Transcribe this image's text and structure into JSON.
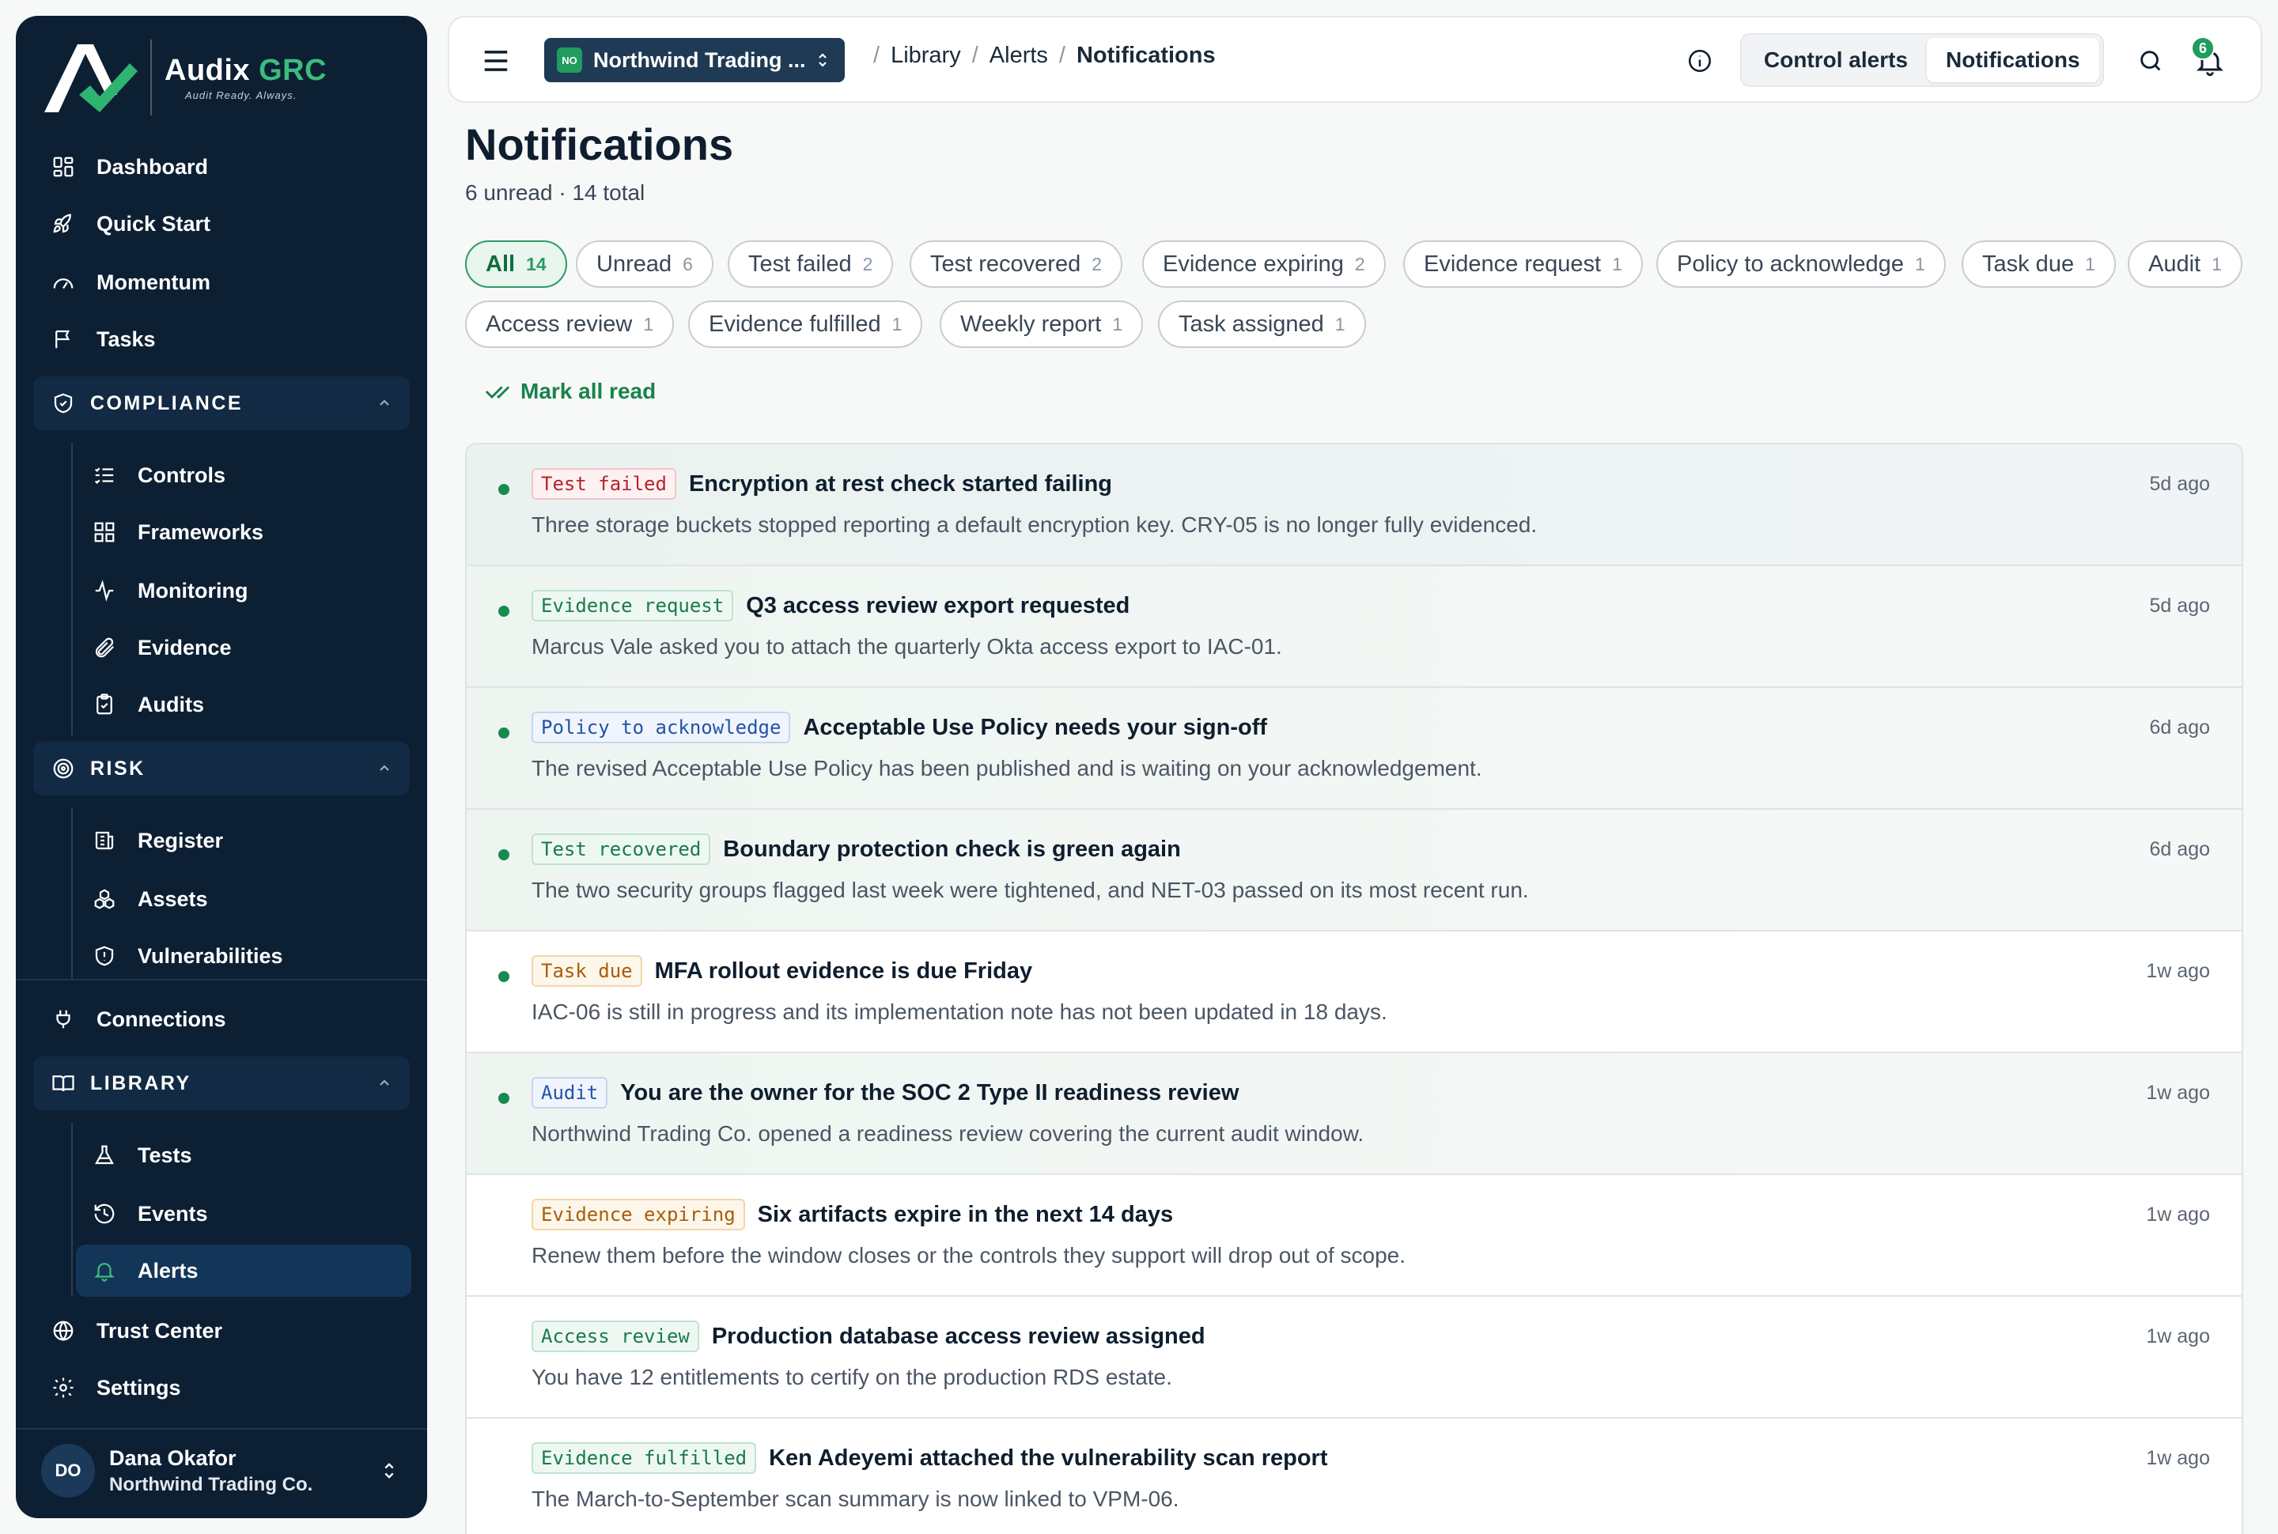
{
  "brand": {
    "name": "Audix",
    "name_accent": "GRC",
    "tagline": "Audit Ready. Always."
  },
  "sidebar": {
    "top_items": [
      {
        "label": "Dashboard",
        "icon": "dashboard-icon"
      },
      {
        "label": "Quick Start",
        "icon": "rocket-icon"
      },
      {
        "label": "Momentum",
        "icon": "gauge-icon"
      },
      {
        "label": "Tasks",
        "icon": "flag-icon"
      }
    ],
    "compliance": {
      "label": "COMPLIANCE",
      "items": [
        {
          "label": "Controls",
          "icon": "list-check-icon"
        },
        {
          "label": "Frameworks",
          "icon": "grid-icon"
        },
        {
          "label": "Monitoring",
          "icon": "pulse-icon"
        },
        {
          "label": "Evidence",
          "icon": "paperclip-icon"
        },
        {
          "label": "Audits",
          "icon": "clipboard-icon"
        }
      ]
    },
    "risk": {
      "label": "RISK",
      "items": [
        {
          "label": "Register",
          "icon": "register-icon"
        },
        {
          "label": "Assets",
          "icon": "cubes-icon"
        },
        {
          "label": "Vulnerabilities",
          "icon": "shield-alert-icon"
        }
      ]
    },
    "connections": {
      "label": "Connections",
      "icon": "plug-icon"
    },
    "library": {
      "label": "LIBRARY",
      "items": [
        {
          "label": "Tests",
          "icon": "flask-icon"
        },
        {
          "label": "Events",
          "icon": "history-icon"
        },
        {
          "label": "Alerts",
          "icon": "bell-icon"
        }
      ]
    },
    "bottom_items": [
      {
        "label": "Trust Center",
        "icon": "globe-icon"
      },
      {
        "label": "Settings",
        "icon": "gear-icon"
      }
    ],
    "user": {
      "initials": "DO",
      "name": "Dana Okafor",
      "org": "Northwind Trading Co."
    }
  },
  "topbar": {
    "org_badge": "NO",
    "org_name": "Northwind Trading ...",
    "breadcrumb": [
      "Library",
      "Alerts",
      "Notifications"
    ],
    "tabs": [
      "Control alerts",
      "Notifications"
    ],
    "active_tab": "Notifications",
    "bell_count": "6"
  },
  "page": {
    "title": "Notifications",
    "subtitle": "6 unread · 14 total",
    "mark_all_read": "Mark all read"
  },
  "filters": [
    {
      "label": "All",
      "count": "14",
      "active": true
    },
    {
      "label": "Unread",
      "count": "6"
    },
    {
      "label": "Test failed",
      "count": "2"
    },
    {
      "label": "Test recovered",
      "count": "2"
    },
    {
      "label": "Evidence expiring",
      "count": "2"
    },
    {
      "label": "Evidence request",
      "count": "1"
    },
    {
      "label": "Policy to acknowledge",
      "count": "1"
    },
    {
      "label": "Task due",
      "count": "1"
    },
    {
      "label": "Audit",
      "count": "1"
    },
    {
      "label": "Access review",
      "count": "1"
    },
    {
      "label": "Evidence fulfilled",
      "count": "1"
    },
    {
      "label": "Weekly report",
      "count": "1"
    },
    {
      "label": "Task assigned",
      "count": "1"
    }
  ],
  "notifications": [
    {
      "tag": "Test failed",
      "tag_color": "red",
      "title": "Encryption at rest check started failing",
      "desc": "Three storage buckets stopped reporting a default encryption key. CRY-05 is no longer fully evidenced.",
      "time": "5d ago",
      "unread": true
    },
    {
      "tag": "Evidence request",
      "tag_color": "green",
      "title": "Q3 access review export requested",
      "desc": "Marcus Vale asked you to attach the quarterly Okta access export to IAC-01.",
      "time": "5d ago",
      "unread": true
    },
    {
      "tag": "Policy to acknowledge",
      "tag_color": "blue",
      "title": "Acceptable Use Policy needs your sign-off",
      "desc": "The revised Acceptable Use Policy has been published and is waiting on your acknowledgement.",
      "time": "6d ago",
      "unread": true
    },
    {
      "tag": "Test recovered",
      "tag_color": "green",
      "title": "Boundary protection check is green again",
      "desc": "The two security groups flagged last week were tightened, and NET-03 passed on its most recent run.",
      "time": "6d ago",
      "unread": true
    },
    {
      "tag": "Task due",
      "tag_color": "amber",
      "title": "MFA rollout evidence is due Friday",
      "desc": "IAC-06 is still in progress and its implementation note has not been updated in 18 days.",
      "time": "1w ago",
      "unread": true
    },
    {
      "tag": "Audit",
      "tag_color": "blue",
      "title": "You are the owner for the SOC 2 Type II readiness review",
      "desc": "Northwind Trading Co. opened a readiness review covering the current audit window.",
      "time": "1w ago",
      "unread": true
    },
    {
      "tag": "Evidence expiring",
      "tag_color": "amber",
      "title": "Six artifacts expire in the next 14 days",
      "desc": "Renew them before the window closes or the controls they support will drop out of scope.",
      "time": "1w ago",
      "unread": false
    },
    {
      "tag": "Access review",
      "tag_color": "green",
      "title": "Production database access review assigned",
      "desc": "You have 12 entitlements to certify on the production RDS estate.",
      "time": "1w ago",
      "unread": false
    },
    {
      "tag": "Evidence fulfilled",
      "tag_color": "green",
      "title": "Ken Adeyemi attached the vulnerability scan report",
      "desc": "The March-to-September scan summary is now linked to VPM-06.",
      "time": "1w ago",
      "unread": false
    }
  ]
}
